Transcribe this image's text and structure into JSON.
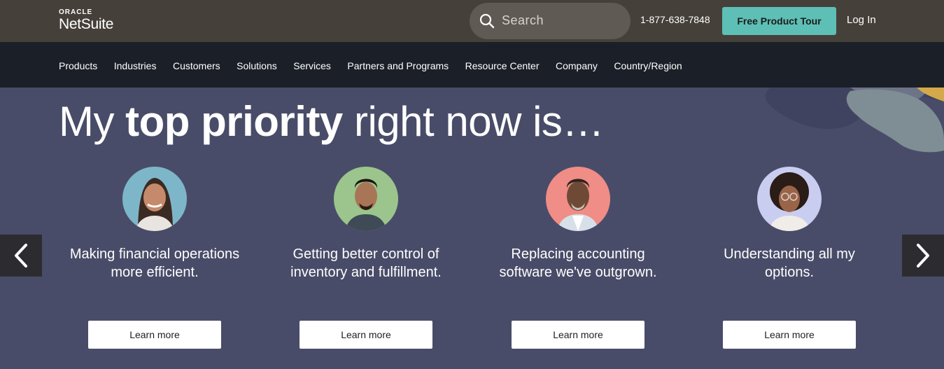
{
  "header": {
    "logo_top": "ORACLE",
    "logo_main": "NetSuite",
    "search_placeholder": "Search",
    "phone": "1-877-638-7848",
    "tour_label": "Free Product Tour",
    "login_label": "Log In"
  },
  "nav": {
    "items": [
      "Products",
      "Industries",
      "Customers",
      "Solutions",
      "Services",
      "Partners and Programs",
      "Resource Center",
      "Company",
      "Country/Region"
    ]
  },
  "hero": {
    "headline_pre": "My ",
    "headline_bold": "top priority",
    "headline_post": " right now is…",
    "cards": [
      {
        "text": "Making financial operations more efficient.",
        "button": "Learn more",
        "avatar_bg": "#7eb6c9"
      },
      {
        "text": "Getting better control of inventory and fulfillment.",
        "button": "Learn more",
        "avatar_bg": "#9bc58c"
      },
      {
        "text": "Replacing accounting software we've outgrown.",
        "button": "Learn more",
        "avatar_bg": "#ef8d86"
      },
      {
        "text": "Understanding all my options.",
        "button": "Learn more",
        "avatar_bg": "#c9cdf0"
      }
    ]
  },
  "colors": {
    "topbar": "#46403a",
    "navbar": "#1b2028",
    "hero": "#494c68",
    "accent": "#5ebfb6"
  }
}
